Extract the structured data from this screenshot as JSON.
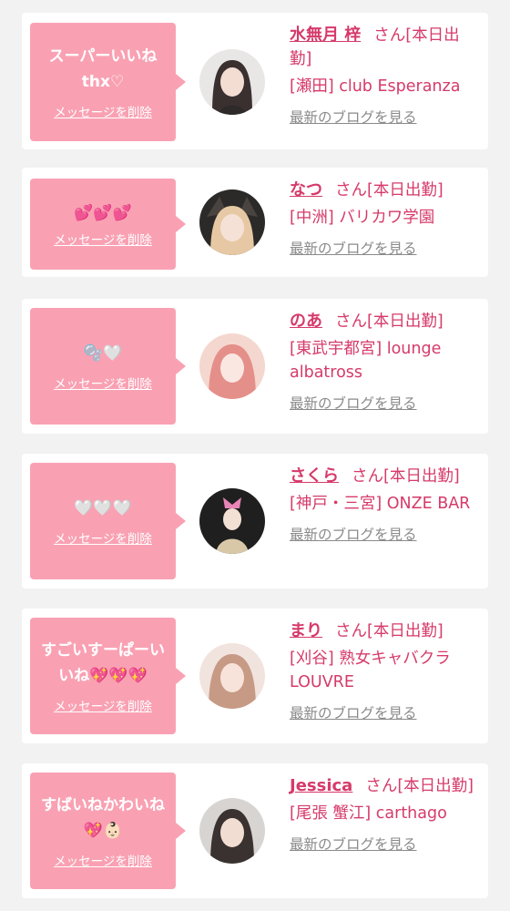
{
  "ui": {
    "delete_label": "メッセージを削除",
    "blog_label": "最新のブログを見る",
    "san_label": "さん[本日出勤]"
  },
  "colors": {
    "accent": "#f9a1b3",
    "text_pink": "#d63a6a",
    "link_gray": "#8a8a8a"
  },
  "items": [
    {
      "message": "スーパーいいね\nthx♡",
      "name": "水無月 梓",
      "shop": "[瀬田] club Esperanza"
    },
    {
      "message": "💕💕💕",
      "name": "なつ",
      "shop": "[中洲] バリカワ学園"
    },
    {
      "message": "🫧🤍",
      "name": "のあ",
      "shop": "[東武宇都宮] lounge albatross"
    },
    {
      "message": "🤍🤍🤍",
      "name": "さくら",
      "shop": "[神戸・三宮] ONZE BAR"
    },
    {
      "message": "すごいすーぱーい\nいね💖💖💖",
      "name": "まり",
      "shop": "[刈谷] 熟女キャバクラ LOUVRE"
    },
    {
      "message": "すばいねかわいね\n💖👶🏻",
      "name": "Jessica",
      "shop": "[尾張 蟹江] carthago"
    }
  ]
}
